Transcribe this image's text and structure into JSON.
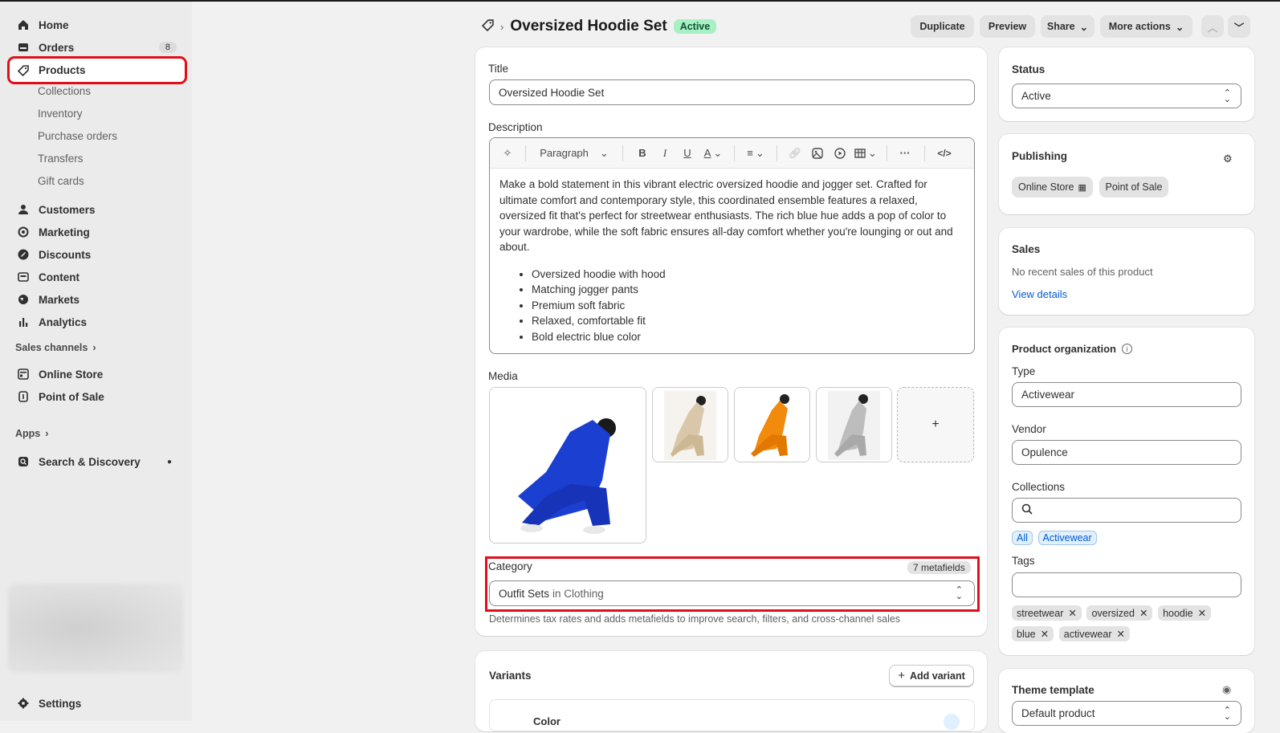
{
  "sidebar": {
    "items": [
      {
        "label": "Home",
        "icon": "home-icon"
      },
      {
        "label": "Orders",
        "icon": "orders-icon",
        "badge": "8"
      },
      {
        "label": "Products",
        "icon": "tag-icon"
      },
      {
        "label": "Customers",
        "icon": "person-icon"
      },
      {
        "label": "Marketing",
        "icon": "target-icon"
      },
      {
        "label": "Discounts",
        "icon": "discount-icon"
      },
      {
        "label": "Content",
        "icon": "image-icon"
      },
      {
        "label": "Markets",
        "icon": "globe-icon"
      },
      {
        "label": "Analytics",
        "icon": "chart-icon"
      }
    ],
    "product_sub": [
      "Collections",
      "Inventory",
      "Purchase orders",
      "Transfers",
      "Gift cards"
    ],
    "sales_channels_label": "Sales channels",
    "channels": [
      {
        "label": "Online Store"
      },
      {
        "label": "Point of Sale"
      }
    ],
    "apps_label": "Apps",
    "search_discovery": "Search & Discovery",
    "settings": "Settings"
  },
  "header": {
    "title": "Oversized Hoodie Set",
    "status": "Active",
    "buttons": {
      "duplicate": "Duplicate",
      "preview": "Preview",
      "share": "Share",
      "more": "More actions"
    }
  },
  "main": {
    "title_label": "Title",
    "title_value": "Oversized Hoodie Set",
    "description_label": "Description",
    "paragraph_select": "Paragraph",
    "description_text": "Make a bold statement in this vibrant electric oversized hoodie and jogger set. Crafted for ultimate comfort and contemporary style, this coordinated ensemble features a relaxed, oversized fit that's perfect for streetwear enthusiasts. The rich blue hue adds a pop of color to your wardrobe, while the soft fabric ensures all-day comfort whether you're lounging or out and about.",
    "bullets": [
      "Oversized hoodie with hood",
      "Matching jogger pants",
      "Premium soft fabric",
      "Relaxed, comfortable fit",
      "Bold electric blue color"
    ],
    "media_label": "Media",
    "media_add": "+",
    "category_label": "Category",
    "metafields": "7 metafields",
    "category_value": "Outfit Sets",
    "category_parent": "in Clothing",
    "category_help": "Determines tax rates and adds metafields to improve search, filters, and cross-channel sales",
    "variants_label": "Variants",
    "add_variant": "Add variant",
    "variant_option": "Color"
  },
  "right": {
    "status_label": "Status",
    "status_value": "Active",
    "publishing_label": "Publishing",
    "channels": [
      "Online Store",
      "Point of Sale"
    ],
    "sales_label": "Sales",
    "sales_text": "No recent sales of this product",
    "view_details": "View details",
    "org_label": "Product organization",
    "type_label": "Type",
    "type_value": "Activewear",
    "vendor_label": "Vendor",
    "vendor_value": "Opulence",
    "collections_label": "Collections",
    "collection_tags": [
      "All",
      "Activewear"
    ],
    "tags_label": "Tags",
    "tags": [
      "streetwear",
      "oversized",
      "hoodie",
      "blue",
      "activewear"
    ],
    "theme_label": "Theme template",
    "theme_value": "Default product"
  },
  "colors": {
    "accent": "#005bd3",
    "highlight": "#e0101a",
    "active_badge": "#a8f0c4",
    "hoodie_blue": "#1a3fd1",
    "hoodie_orange": "#f28a0c"
  }
}
